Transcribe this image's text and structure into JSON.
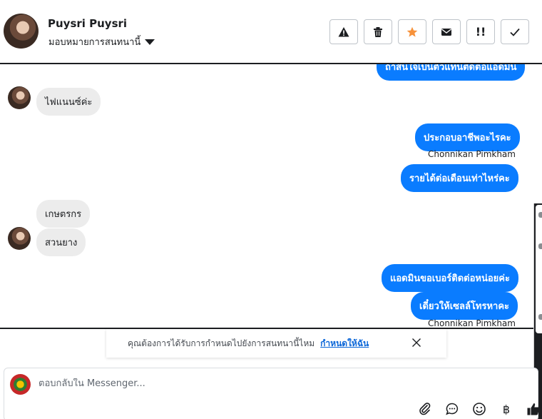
{
  "header": {
    "user_name": "Puysri Puysri",
    "assign_label": "มอบหมายการสนทนานี้",
    "actions": [
      {
        "name": "report-button",
        "icon": "warning-icon",
        "glyph": ""
      },
      {
        "name": "delete-button",
        "icon": "trash-icon",
        "glyph": ""
      },
      {
        "name": "star-button",
        "icon": "star-icon",
        "glyph": "",
        "color": "#f7923b"
      },
      {
        "name": "mark-unread-button",
        "icon": "envelope-icon",
        "glyph": ""
      },
      {
        "name": "follow-up-button",
        "icon": "double-exclamation-icon",
        "glyph": "!!"
      },
      {
        "name": "mark-done-button",
        "icon": "check-icon",
        "glyph": ""
      }
    ]
  },
  "messages": {
    "top_partial": "ถ้าสนใจเป็นตัวแทนติดต่อแอดมิน",
    "m1": "ไฟแนนซ์ค่ะ",
    "m2": "ประกอบอาชีพอะไรคะ",
    "m2_sender": "Chonnikan Pimkham",
    "m3": "รายได้ต่อเดือนเท่าไหร่คะ",
    "m4": "เกษตรกร",
    "m5": "สวนยาง",
    "m6": "แอดมินขอเบอร์ติดต่อหน่อยค่ะ",
    "m7": "เดี๋ยวให้เซลล์โทรหาคะ",
    "m7_sender": "Chonnikan Pimkham"
  },
  "prompt": {
    "text": "คุณต้องการได้รับการกำหนดไปยังการสนทนานี้ไหม",
    "link": "กำหนดให้ฉัน"
  },
  "composer": {
    "placeholder": "ตอบกลับใน Messenger..."
  },
  "tools": {
    "baht_symbol": "฿"
  },
  "colors": {
    "outgoing_bubble": "#0a7cff",
    "incoming_bubble": "#ececec",
    "link": "#0a66d8",
    "star": "#f7923b"
  }
}
